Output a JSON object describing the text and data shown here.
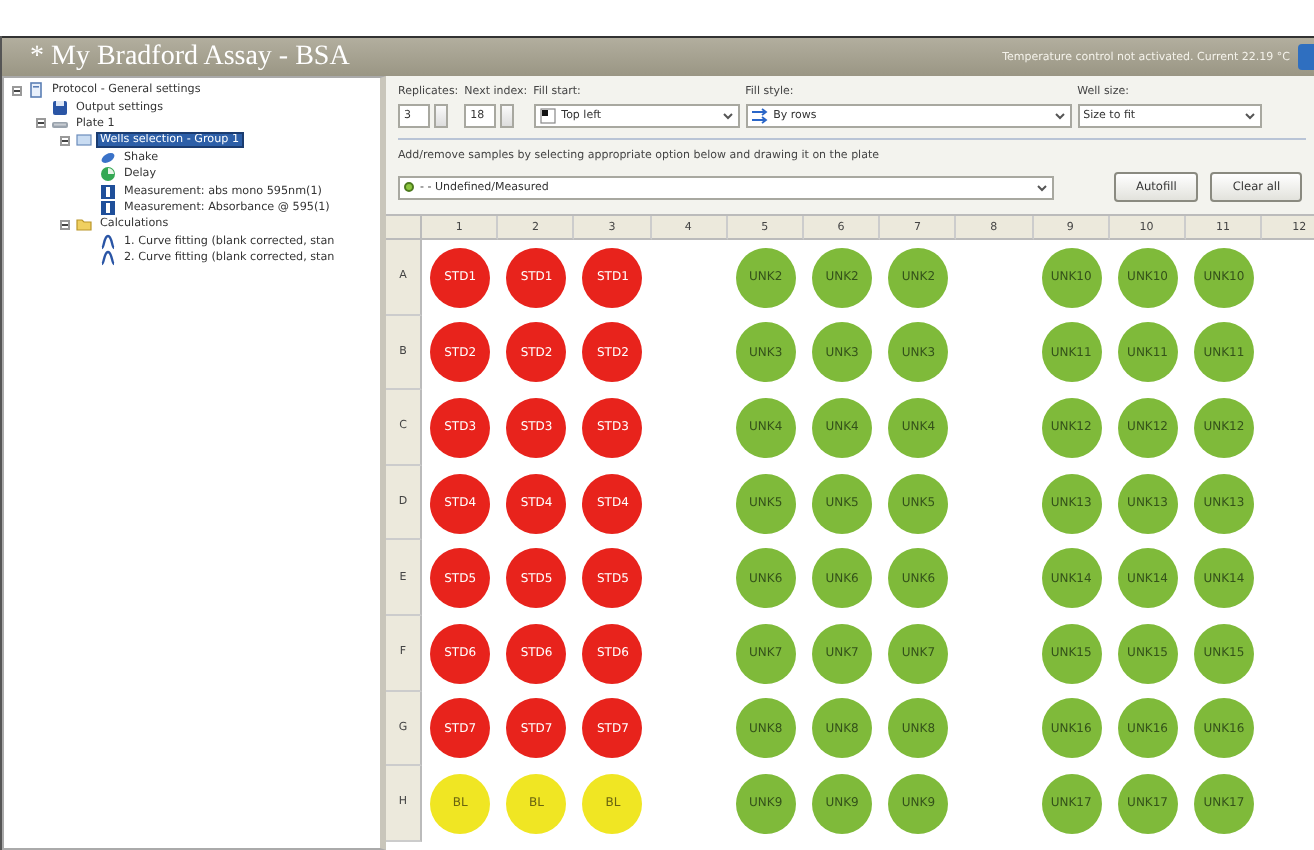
{
  "window": {
    "title": "* My Bradford Assay - BSA",
    "status": "Temperature control not activated. Current 22.19 °C"
  },
  "tree": [
    {
      "label": "Protocol - General settings",
      "kind": "protocol",
      "expanded": true,
      "selected": false,
      "children": [
        {
          "label": "Output settings",
          "kind": "disk",
          "selected": false
        },
        {
          "label": "Plate 1",
          "kind": "plate",
          "expanded": true,
          "selected": false,
          "children": [
            {
              "label": "Wells selection - Group 1",
              "kind": "wells",
              "expanded": true,
              "selected": true,
              "children": [
                {
                  "label": "Shake",
                  "kind": "shake",
                  "selected": false
                },
                {
                  "label": "Delay",
                  "kind": "delay",
                  "selected": false
                },
                {
                  "label": "Measurement: abs mono 595nm(1)",
                  "kind": "measure",
                  "selected": false
                },
                {
                  "label": "Measurement: Absorbance @ 595(1)",
                  "kind": "measure",
                  "selected": false
                }
              ]
            },
            {
              "label": "Calculations",
              "kind": "folder",
              "expanded": true,
              "selected": false,
              "children": [
                {
                  "label": "1. Curve fitting (blank corrected, stan",
                  "kind": "curve",
                  "selected": false
                },
                {
                  "label": "2. Curve fitting (blank corrected, stan",
                  "kind": "curve",
                  "selected": false
                }
              ]
            }
          ]
        }
      ]
    }
  ],
  "settings": {
    "replicates": {
      "label": "Replicates:",
      "value": "3"
    },
    "next_index": {
      "label": "Next index:",
      "value": "18"
    },
    "fill_start": {
      "label": "Fill start:",
      "value": "Top left"
    },
    "fill_style": {
      "label": "Fill style:",
      "value": "By rows"
    },
    "well_size": {
      "label": "Well size:",
      "value": "Size to fit"
    }
  },
  "sample_hint": "Add/remove samples by selecting appropriate option below and drawing it on the plate",
  "sample_type": {
    "value": "- - Undefined/Measured",
    "color": "#8cc63f"
  },
  "buttons": [
    "Autofill",
    "Clear all"
  ],
  "plate": {
    "columns": [
      "1",
      "2",
      "3",
      "4",
      "5",
      "6",
      "7",
      "8",
      "9",
      "10",
      "11",
      "12"
    ],
    "rows": [
      {
        "label": "A",
        "wells": [
          {
            "kind": "standard",
            "label": "STD1"
          },
          {
            "kind": "standard",
            "label": "STD1"
          },
          {
            "kind": "standard",
            "label": "STD1"
          },
          {
            "kind": "empty"
          },
          {
            "kind": "unknown",
            "label": "UNK2"
          },
          {
            "kind": "unknown",
            "label": "UNK2"
          },
          {
            "kind": "unknown",
            "label": "UNK2"
          },
          {
            "kind": "empty"
          },
          {
            "kind": "unknown",
            "label": "UNK10"
          },
          {
            "kind": "unknown",
            "label": "UNK10"
          },
          {
            "kind": "unknown",
            "label": "UNK10"
          },
          {
            "kind": "empty"
          }
        ]
      },
      {
        "label": "B",
        "wells": [
          {
            "kind": "standard",
            "label": "STD2"
          },
          {
            "kind": "standard",
            "label": "STD2"
          },
          {
            "kind": "standard",
            "label": "STD2"
          },
          {
            "kind": "empty"
          },
          {
            "kind": "unknown",
            "label": "UNK3"
          },
          {
            "kind": "unknown",
            "label": "UNK3"
          },
          {
            "kind": "unknown",
            "label": "UNK3"
          },
          {
            "kind": "empty"
          },
          {
            "kind": "unknown",
            "label": "UNK11"
          },
          {
            "kind": "unknown",
            "label": "UNK11"
          },
          {
            "kind": "unknown",
            "label": "UNK11"
          },
          {
            "kind": "empty"
          }
        ]
      },
      {
        "label": "C",
        "wells": [
          {
            "kind": "standard",
            "label": "STD3"
          },
          {
            "kind": "standard",
            "label": "STD3"
          },
          {
            "kind": "standard",
            "label": "STD3"
          },
          {
            "kind": "empty"
          },
          {
            "kind": "unknown",
            "label": "UNK4"
          },
          {
            "kind": "unknown",
            "label": "UNK4"
          },
          {
            "kind": "unknown",
            "label": "UNK4"
          },
          {
            "kind": "empty"
          },
          {
            "kind": "unknown",
            "label": "UNK12"
          },
          {
            "kind": "unknown",
            "label": "UNK12"
          },
          {
            "kind": "unknown",
            "label": "UNK12"
          },
          {
            "kind": "empty"
          }
        ]
      },
      {
        "label": "D",
        "wells": [
          {
            "kind": "standard",
            "label": "STD4"
          },
          {
            "kind": "standard",
            "label": "STD4"
          },
          {
            "kind": "standard",
            "label": "STD4"
          },
          {
            "kind": "empty"
          },
          {
            "kind": "unknown",
            "label": "UNK5"
          },
          {
            "kind": "unknown",
            "label": "UNK5"
          },
          {
            "kind": "unknown",
            "label": "UNK5"
          },
          {
            "kind": "empty"
          },
          {
            "kind": "unknown",
            "label": "UNK13"
          },
          {
            "kind": "unknown",
            "label": "UNK13"
          },
          {
            "kind": "unknown",
            "label": "UNK13"
          },
          {
            "kind": "empty"
          }
        ]
      },
      {
        "label": "E",
        "wells": [
          {
            "kind": "standard",
            "label": "STD5"
          },
          {
            "kind": "standard",
            "label": "STD5"
          },
          {
            "kind": "standard",
            "label": "STD5"
          },
          {
            "kind": "empty"
          },
          {
            "kind": "unknown",
            "label": "UNK6"
          },
          {
            "kind": "unknown",
            "label": "UNK6"
          },
          {
            "kind": "unknown",
            "label": "UNK6"
          },
          {
            "kind": "empty"
          },
          {
            "kind": "unknown",
            "label": "UNK14"
          },
          {
            "kind": "unknown",
            "label": "UNK14"
          },
          {
            "kind": "unknown",
            "label": "UNK14"
          },
          {
            "kind": "empty"
          }
        ]
      },
      {
        "label": "F",
        "wells": [
          {
            "kind": "standard",
            "label": "STD6"
          },
          {
            "kind": "standard",
            "label": "STD6"
          },
          {
            "kind": "standard",
            "label": "STD6"
          },
          {
            "kind": "empty"
          },
          {
            "kind": "unknown",
            "label": "UNK7"
          },
          {
            "kind": "unknown",
            "label": "UNK7"
          },
          {
            "kind": "unknown",
            "label": "UNK7"
          },
          {
            "kind": "empty"
          },
          {
            "kind": "unknown",
            "label": "UNK15"
          },
          {
            "kind": "unknown",
            "label": "UNK15"
          },
          {
            "kind": "unknown",
            "label": "UNK15"
          },
          {
            "kind": "empty"
          }
        ]
      },
      {
        "label": "G",
        "wells": [
          {
            "kind": "standard",
            "label": "STD7"
          },
          {
            "kind": "standard",
            "label": "STD7"
          },
          {
            "kind": "standard",
            "label": "STD7"
          },
          {
            "kind": "empty"
          },
          {
            "kind": "unknown",
            "label": "UNK8"
          },
          {
            "kind": "unknown",
            "label": "UNK8"
          },
          {
            "kind": "unknown",
            "label": "UNK8"
          },
          {
            "kind": "empty"
          },
          {
            "kind": "unknown",
            "label": "UNK16"
          },
          {
            "kind": "unknown",
            "label": "UNK16"
          },
          {
            "kind": "unknown",
            "label": "UNK16"
          },
          {
            "kind": "empty"
          }
        ]
      },
      {
        "label": "H",
        "wells": [
          {
            "kind": "blank",
            "label": "BL"
          },
          {
            "kind": "blank",
            "label": "BL"
          },
          {
            "kind": "blank",
            "label": "BL"
          },
          {
            "kind": "empty"
          },
          {
            "kind": "unknown",
            "label": "UNK9"
          },
          {
            "kind": "unknown",
            "label": "UNK9"
          },
          {
            "kind": "unknown",
            "label": "UNK9"
          },
          {
            "kind": "empty"
          },
          {
            "kind": "unknown",
            "label": "UNK17"
          },
          {
            "kind": "unknown",
            "label": "UNK17"
          },
          {
            "kind": "unknown",
            "label": "UNK17"
          },
          {
            "kind": "empty"
          }
        ]
      }
    ]
  }
}
